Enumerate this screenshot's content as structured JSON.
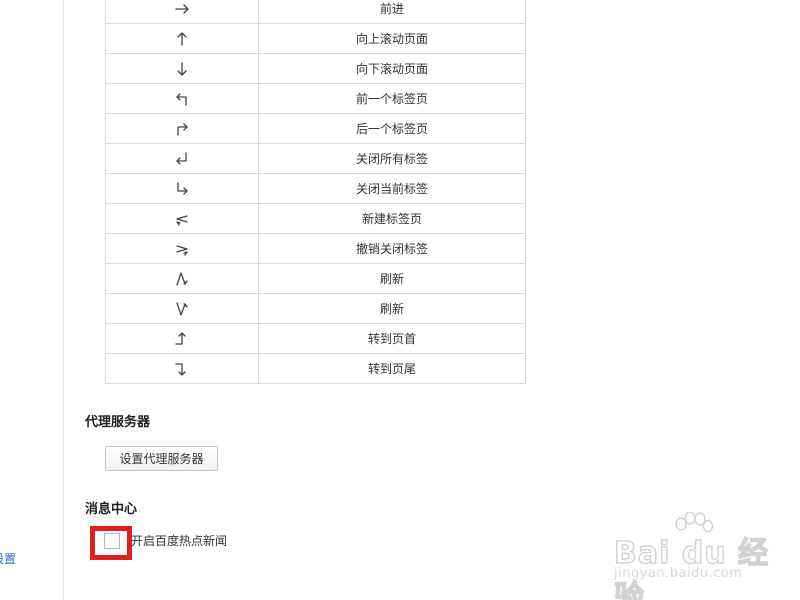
{
  "left_nav": {
    "partial_link": "设置"
  },
  "gestures": {
    "rows": [
      {
        "icon": "arrow-right-icon",
        "action": "前进"
      },
      {
        "icon": "arrow-up-icon",
        "action": "向上滚动页面"
      },
      {
        "icon": "arrow-down-icon",
        "action": "向下滚动页面"
      },
      {
        "icon": "up-left-icon",
        "action": "前一个标签页"
      },
      {
        "icon": "up-right-icon",
        "action": "后一个标签页"
      },
      {
        "icon": "down-left-icon",
        "action": "关闭所有标签"
      },
      {
        "icon": "down-right-icon",
        "action": "关闭当前标签"
      },
      {
        "icon": "left-right-left-icon",
        "action": "新建标签页"
      },
      {
        "icon": "right-left-right-icon",
        "action": "撤销关闭标签"
      },
      {
        "icon": "up-down-up-icon",
        "action": "刷新"
      },
      {
        "icon": "down-up-down-icon",
        "action": "刷新"
      },
      {
        "icon": "right-up-icon",
        "action": "转到页首"
      },
      {
        "icon": "right-down-icon",
        "action": "转到页尾"
      }
    ]
  },
  "proxy": {
    "title": "代理服务器",
    "button_label": "设置代理服务器"
  },
  "message_center": {
    "title": "消息中心",
    "checkbox_label": "开启百度热点新闻",
    "checked": false
  },
  "watermark": {
    "logo_text": "Bai du 经验",
    "url": "jingyan.baidu.com"
  },
  "colors": {
    "highlight": "#e02020",
    "link": "#2a6ecf",
    "border": "#dcdcdc"
  }
}
